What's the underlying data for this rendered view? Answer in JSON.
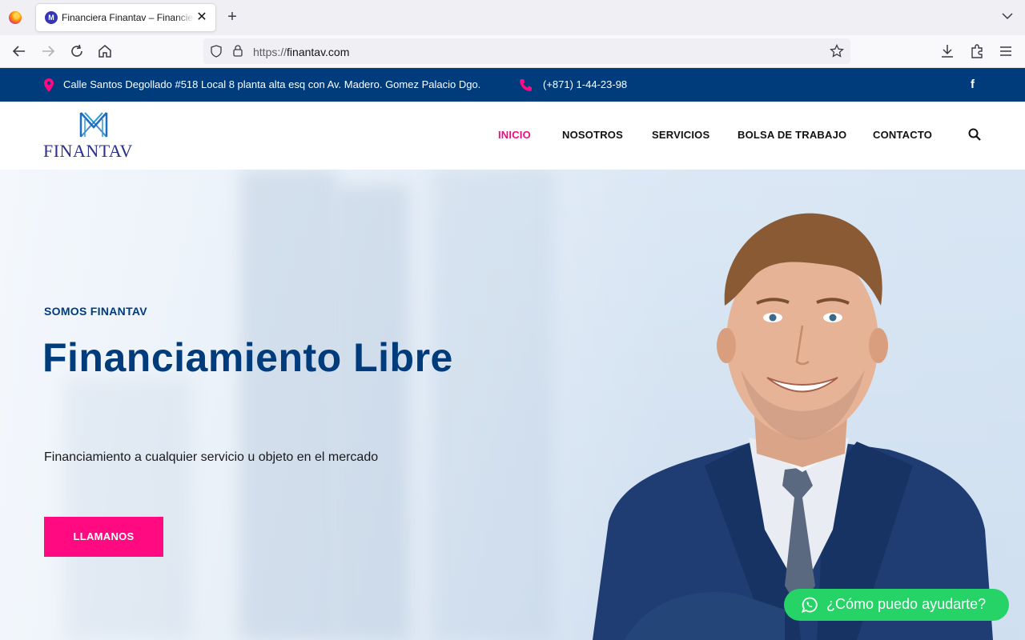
{
  "browser": {
    "tab_title": "Financiera Finantav – Financiera",
    "url_protocol": "https://",
    "url_host": "finantav.com"
  },
  "topbar": {
    "address": "Calle Santos Degollado #518 Local 8 planta alta esq con Av. Madero. Gomez Palacio Dgo.",
    "phone": "(+871) 1-44-23-98",
    "social_icon": "facebook-icon"
  },
  "logo": {
    "text": "FINANTAV"
  },
  "menu": [
    {
      "label": "INICIO",
      "active": true
    },
    {
      "label": "NOSOTROS",
      "active": false
    },
    {
      "label": "SERVICIOS",
      "active": false
    },
    {
      "label": "BOLSA DE TRABAJO",
      "active": false
    },
    {
      "label": "CONTACTO",
      "active": false
    }
  ],
  "hero": {
    "kicker": "SOMOS FINANTAV",
    "title": "Financiamiento Libre",
    "subtitle": "Financiamiento a cualquier servicio u objeto en el mercado",
    "cta_label": "LLAMANOS"
  },
  "whatsapp": {
    "label": "¿Cómo puedo ayudarte?"
  },
  "colors": {
    "brand_blue": "#003b7c",
    "accent_pink": "#ff0a80",
    "whatsapp_green": "#25d366"
  }
}
